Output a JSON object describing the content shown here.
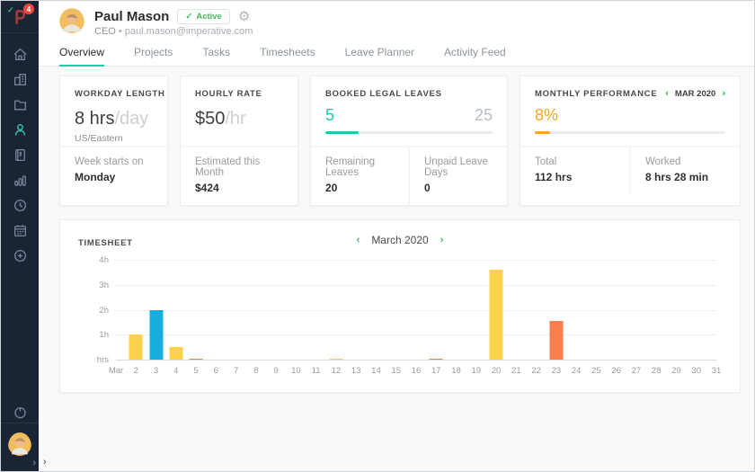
{
  "colors": {
    "accent_teal": "#1fc8a9",
    "accent_orange": "#f5a623",
    "nav_green": "#2abb4f",
    "badge_green": "#42b95e",
    "sidebar_bg": "#1b2435"
  },
  "sidebar": {
    "logo_badge_count": "4",
    "logo_check": "✓",
    "items": [
      "home",
      "company",
      "folders",
      "people",
      "invoices",
      "reports",
      "time",
      "calendar",
      "add"
    ],
    "active_item": "people",
    "collapse_chevron": "›"
  },
  "header": {
    "name": "Paul Mason",
    "status_check": "✓",
    "status_label": "Active",
    "gear_icon": "⚙",
    "role": "CEO",
    "separator": "•",
    "email": "paul.mason@imperative.com"
  },
  "tabs": [
    {
      "label": "Overview",
      "active": true
    },
    {
      "label": "Projects",
      "active": false
    },
    {
      "label": "Tasks",
      "active": false
    },
    {
      "label": "Timesheets",
      "active": false
    },
    {
      "label": "Leave Planner",
      "active": false
    },
    {
      "label": "Activity Feed",
      "active": false
    }
  ],
  "nav_glyphs": {
    "prev": "‹",
    "next": "›"
  },
  "cards": {
    "workday": {
      "title": "WORKDAY LENGTH",
      "value": "8 hrs",
      "unit": "/day",
      "timezone": "US/Eastern",
      "footer_label": "Week starts on",
      "footer_value": "Monday"
    },
    "hourly": {
      "title": "HOURLY RATE",
      "value": "$50",
      "unit": "/hr",
      "footer_label": "Estimated this Month",
      "footer_value": "$424"
    },
    "leaves": {
      "title": "BOOKED LEGAL LEAVES",
      "used": "5",
      "total": "25",
      "progress_pct": 20,
      "footer1_label": "Remaining Leaves",
      "footer1_value": "20",
      "footer2_label": "Unpaid Leave Days",
      "footer2_value": "0"
    },
    "performance": {
      "title": "MONTHLY PERFORMANCE",
      "nav_label": "MAR 2020",
      "percent": "8%",
      "progress_pct": 8,
      "footer1_label": "Total",
      "footer1_value": "112 hrs",
      "footer2_label": "Worked",
      "footer2_value": "8 hrs 28 min"
    }
  },
  "chart_data": {
    "type": "bar",
    "title": "TIMESHEET",
    "period_label": "March 2020",
    "ylabel": "hours",
    "ylim": [
      0,
      4
    ],
    "yticks": [
      "hrs",
      "1h",
      "2h",
      "3h",
      "4h"
    ],
    "grid": true,
    "xlabels": [
      "Mar",
      "2",
      "3",
      "4",
      "5",
      "6",
      "7",
      "8",
      "9",
      "10",
      "11",
      "12",
      "13",
      "14",
      "15",
      "16",
      "17",
      "18",
      "19",
      "20",
      "21",
      "22",
      "23",
      "24",
      "25",
      "26",
      "27",
      "28",
      "29",
      "30",
      "31"
    ],
    "bars": [
      {
        "day": 2,
        "hours": 1.0,
        "color": "yellow"
      },
      {
        "day": 3,
        "hours": 2.0,
        "color": "blue"
      },
      {
        "day": 4,
        "hours": 0.5,
        "color": "yellow"
      },
      {
        "day": 5,
        "hours": 0.05,
        "color": "orange"
      },
      {
        "day": 12,
        "hours": 0.04,
        "color": "yellow"
      },
      {
        "day": 17,
        "hours": 0.05,
        "color": "orange"
      },
      {
        "day": 20,
        "hours": 3.6,
        "color": "yellow"
      },
      {
        "day": 23,
        "hours": 1.55,
        "color": "orange"
      }
    ],
    "colors": {
      "yellow": "#fcd24d",
      "blue": "#16aede",
      "orange": "#f87e50"
    }
  }
}
